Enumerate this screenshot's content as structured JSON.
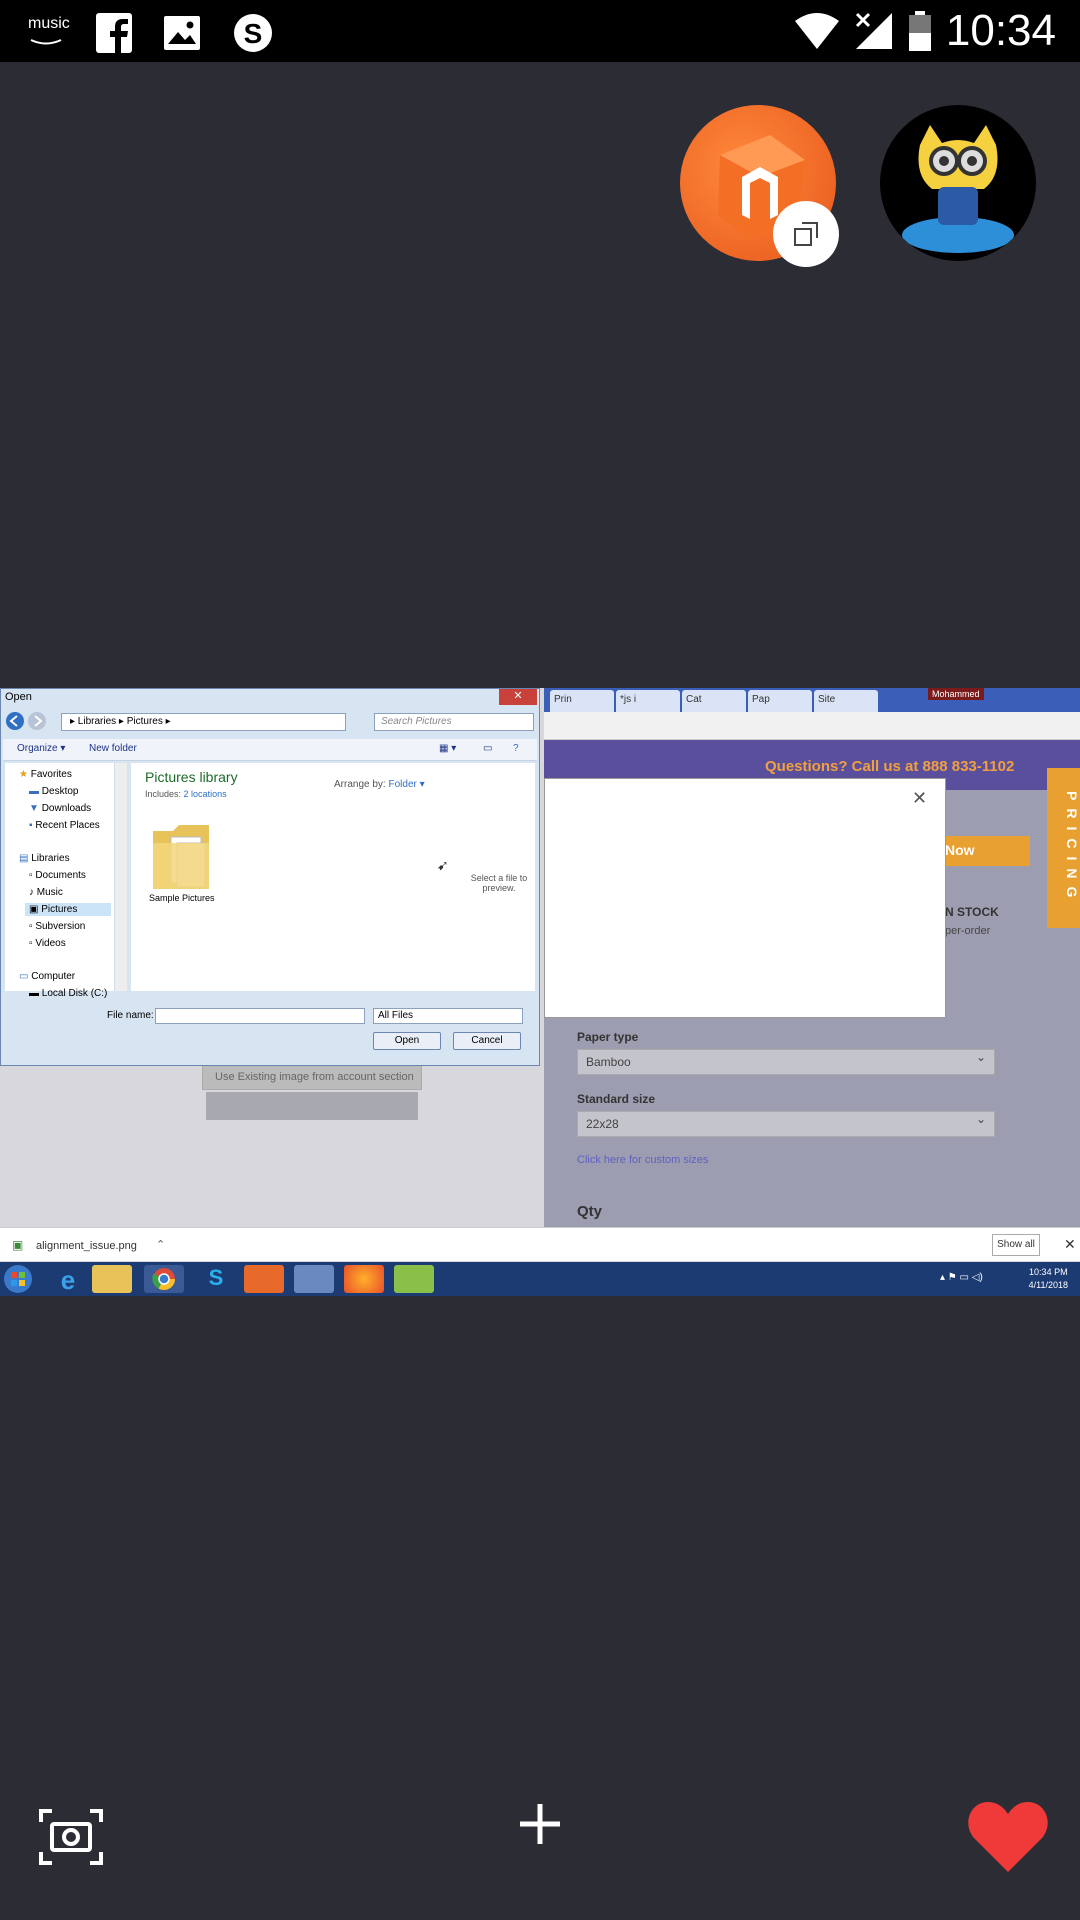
{
  "status_bar": {
    "time": "10:34",
    "left_icons": [
      "amazon-music-icon",
      "facebook-icon",
      "gallery-icon",
      "skype-icon"
    ],
    "right_icons": [
      "wifi-icon",
      "signal-icon",
      "battery-icon"
    ],
    "amazon_text": "music"
  },
  "chat_heads": [
    {
      "name": "magento-avatar"
    },
    {
      "name": "octocat-avatar"
    }
  ],
  "screenshot": {
    "dialog": {
      "title": "Open",
      "breadcrumb": "▸  Libraries  ▸  Pictures  ▸",
      "search_placeholder": "Search Pictures",
      "toolbar": {
        "organize": "Organize ▾",
        "new_folder": "New folder"
      },
      "nav": {
        "favorites": "Favorites",
        "desktop": "Desktop",
        "downloads": "Downloads",
        "recent": "Recent Places",
        "libraries": "Libraries",
        "documents": "Documents",
        "music": "Music",
        "pictures": "Pictures",
        "subversion": "Subversion",
        "videos": "Videos",
        "computer": "Computer",
        "local_disk": "Local Disk (C:)"
      },
      "library_title": "Pictures library",
      "includes_label": "Includes:",
      "includes_link": "2 locations",
      "arrange_label": "Arrange by:",
      "arrange_value": "Folder ▾",
      "folder_label": "Sample Pictures",
      "preview_text": "Select a file to preview.",
      "file_name_label": "File name:",
      "file_type": "All Files",
      "open_button": "Open",
      "cancel_button": "Cancel"
    },
    "browser": {
      "tabs": [
        "Prin",
        "*js i",
        "Cat",
        "Pap",
        "Site"
      ],
      "profile": "Mohammed",
      "site": {
        "phone": "Questions? Call us at 888 833-1102",
        "pricing": "PRICING",
        "now_button": "Now",
        "stock": "N STOCK",
        "preorder": "per-order",
        "paper_type_label": "Paper type",
        "paper_type_value": "Bamboo",
        "standard_size_label": "Standard size",
        "standard_size_value": "22x28",
        "custom_link": "Click here for custom sizes",
        "qty_label": "Qty",
        "use_existing": "Use Existing image from account section"
      }
    },
    "download_bar": {
      "file": "alignment_issue.png",
      "show_all": "Show all"
    },
    "taskbar": {
      "time": "10:34 PM",
      "date": "4/11/2018"
    }
  }
}
